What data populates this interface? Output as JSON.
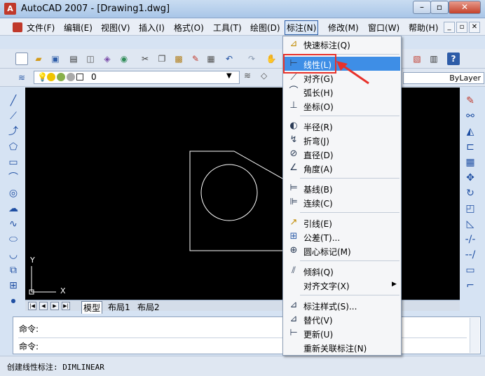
{
  "window": {
    "title": "AutoCAD 2007 - [Drawing1.dwg]",
    "app_icon_glyph": "A"
  },
  "menubar": {
    "items": [
      {
        "label": "文件(F)"
      },
      {
        "label": "编辑(E)"
      },
      {
        "label": "视图(V)"
      },
      {
        "label": "插入(I)"
      },
      {
        "label": "格式(O)"
      },
      {
        "label": "工具(T)"
      },
      {
        "label": "绘图(D)"
      },
      {
        "label": "标注(N)"
      },
      {
        "label": "修改(M)"
      },
      {
        "label": "窗口(W)"
      },
      {
        "label": "帮助(H)"
      }
    ],
    "active_item": "标注(N)"
  },
  "layer_toolbar": {
    "current_layer": "0",
    "linetype": "ByLayer"
  },
  "drawing": {
    "ucs_x_label": "X",
    "ucs_y_label": "Y"
  },
  "layout_tabs": {
    "tabs": [
      {
        "label": "模型"
      },
      {
        "label": "布局1"
      },
      {
        "label": "布局2"
      }
    ],
    "active": "模型"
  },
  "command_line": {
    "line1": "命令:",
    "line2": "命令:"
  },
  "status": {
    "text": "创建线性标注:  DIMLINEAR"
  },
  "dimension_menu": {
    "items": [
      {
        "label": "快速标注(Q)",
        "icon": "quick-dimension-icon",
        "glyph": "⊿"
      },
      {
        "label": "线性(L)",
        "icon": "linear-dimension-icon",
        "glyph": "⊢",
        "highlighted": true
      },
      {
        "label": "对齐(G)",
        "icon": "aligned-dimension-icon",
        "glyph": "⟋"
      },
      {
        "label": "弧长(H)",
        "icon": "arc-length-icon",
        "glyph": "⌒"
      },
      {
        "label": "坐标(O)",
        "icon": "ordinate-icon",
        "glyph": "⊥"
      },
      {
        "label": "半径(R)",
        "icon": "radius-icon",
        "glyph": "◐"
      },
      {
        "label": "折弯(J)",
        "icon": "jogged-icon",
        "glyph": "↯"
      },
      {
        "label": "直径(D)",
        "icon": "diameter-icon",
        "glyph": "⊘"
      },
      {
        "label": "角度(A)",
        "icon": "angular-icon",
        "glyph": "∠"
      },
      {
        "label": "基线(B)",
        "icon": "baseline-icon",
        "glyph": "⊨"
      },
      {
        "label": "连续(C)",
        "icon": "continue-icon",
        "glyph": "⊫"
      },
      {
        "label": "引线(E)",
        "icon": "leader-icon",
        "glyph": "↗"
      },
      {
        "label": "公差(T)...",
        "icon": "tolerance-icon",
        "glyph": "⊞"
      },
      {
        "label": "圆心标记(M)",
        "icon": "center-mark-icon",
        "glyph": "⊕"
      },
      {
        "label": "倾斜(Q)",
        "icon": "oblique-icon",
        "glyph": "⫽"
      },
      {
        "label": "对齐文字(X)",
        "icon": "",
        "glyph": "",
        "submenu": true
      },
      {
        "label": "标注样式(S)...",
        "icon": "dimension-style-icon",
        "glyph": "⊿"
      },
      {
        "label": "替代(V)",
        "icon": "override-icon",
        "glyph": "⊿"
      },
      {
        "label": "更新(U)",
        "icon": "update-icon",
        "glyph": "⊢"
      },
      {
        "label": "重新关联标注(N)",
        "icon": "",
        "glyph": ""
      }
    ]
  },
  "colors": {
    "highlight": "#3e8ee6",
    "annotation_red": "#e8312a",
    "drawing_bg": "#000000"
  }
}
